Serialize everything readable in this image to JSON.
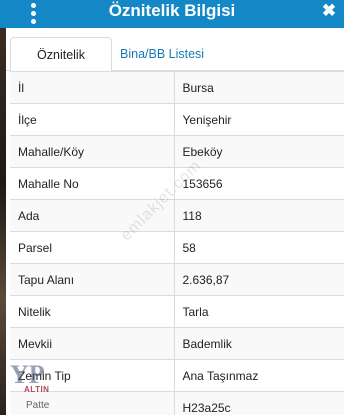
{
  "header": {
    "title": "Öznitelik Bilgisi",
    "close_symbol": "✖"
  },
  "tabs": [
    {
      "label": "Öznitelik Bilgisi",
      "active": true
    },
    {
      "label": "Bina/BB Listesi",
      "active": false
    }
  ],
  "attributes": [
    {
      "key": "İl",
      "value": "Bursa"
    },
    {
      "key": "İlçe",
      "value": "Yenişehir"
    },
    {
      "key": "Mahalle/Köy",
      "value": "Ebeköy"
    },
    {
      "key": "Mahalle No",
      "value": "153656"
    },
    {
      "key": "Ada",
      "value": "118"
    },
    {
      "key": "Parsel",
      "value": "58"
    },
    {
      "key": "Tapu Alanı",
      "value": "2.636,87"
    },
    {
      "key": "Nitelik",
      "value": "Tarla"
    },
    {
      "key": "Mevkii",
      "value": "Bademlik"
    },
    {
      "key": "Zemin Tip",
      "value": "Ana Taşınmaz"
    },
    {
      "key": "",
      "value": "H23a25c"
    }
  ],
  "watermark": {
    "text": "emlakjet.com"
  },
  "logo": {
    "monogram": "YP",
    "brand": "ALTIN",
    "sub": "Patte"
  },
  "colors": {
    "header": "#1488c6",
    "tab_link": "#1a7ab5",
    "border": "#dcdcdc"
  },
  "icons": {
    "menu": "more-vert-icon",
    "close": "close-icon"
  }
}
